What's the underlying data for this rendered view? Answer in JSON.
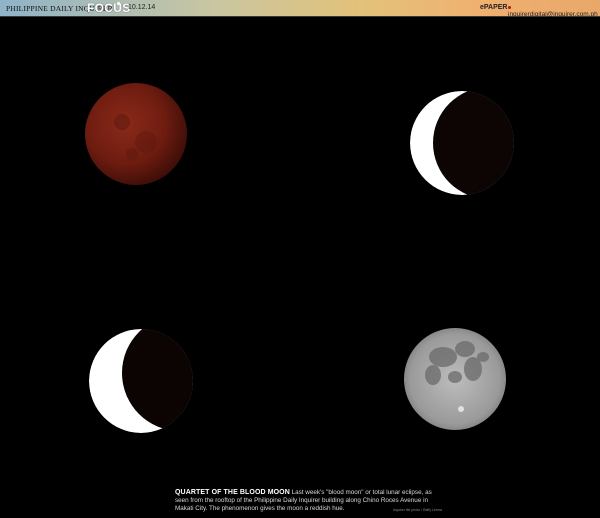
{
  "header": {
    "masthead": "PHILIPPINE DAILY INQUIRER",
    "section": "FOCUS",
    "date": "10.12.14",
    "epaper_label": "ePAPER",
    "email": "inquirerdigital@inquirer.com.ph"
  },
  "caption": {
    "title": "QUARTET OF THE BLOOD MOON",
    "text": "Last week's \"blood moon\" or total lunar eclipse, as seen from the rooftop of the Philippine Daily Inquirer building along Chino Roces Avenue in Makati City. The phenomenon gives the moon a reddish hue.",
    "credit": "Inquirer file photo / Raffy Lerma"
  },
  "photos": [
    {
      "name": "blood-moon-total-eclipse",
      "phase": "total eclipse, reddish"
    },
    {
      "name": "moon-partial-eclipse-thin-crescent",
      "phase": "thin lit crescent on left"
    },
    {
      "name": "moon-partial-eclipse-wide-crescent",
      "phase": "wider lit crescent on left"
    },
    {
      "name": "full-moon",
      "phase": "full moon"
    }
  ],
  "colors": {
    "background": "#000000",
    "blood_moon": "#7a1e12",
    "moon_lit": "#ffffff",
    "full_moon": "#a8a8a8"
  }
}
